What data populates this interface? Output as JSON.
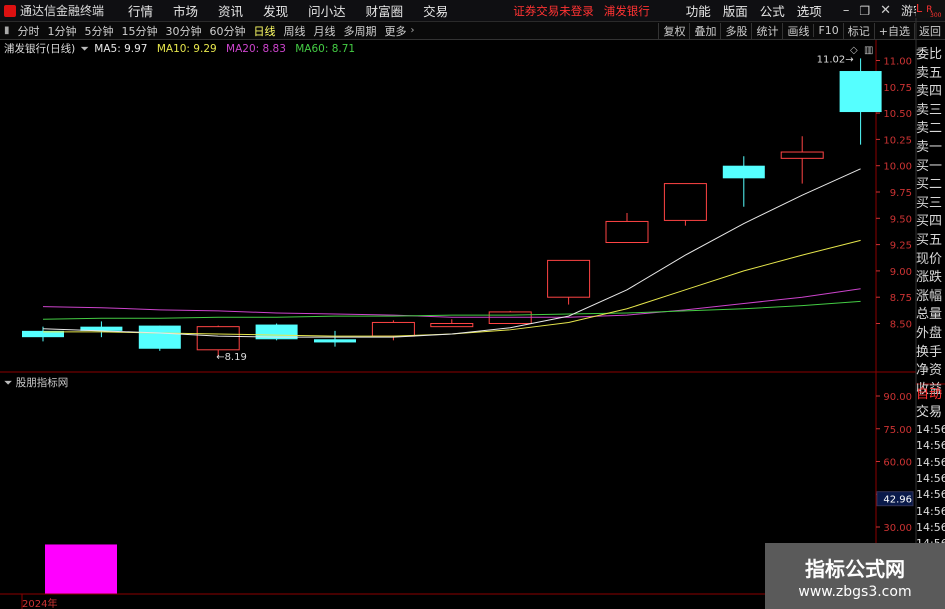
{
  "app": {
    "name": "通达信金融终端",
    "status_left": "证券交易未登录",
    "status_right": "浦发银行"
  },
  "menu": {
    "items": [
      "行情",
      "市场",
      "资讯",
      "发现",
      "问小达",
      "财富圈",
      "交易"
    ],
    "right_items": [
      "功能",
      "版面",
      "公式",
      "选项"
    ],
    "guest": "游客"
  },
  "periods": [
    "分时",
    "1分钟",
    "5分钟",
    "15分钟",
    "30分钟",
    "60分钟",
    "日线",
    "周线",
    "月线",
    "多周期",
    "更多"
  ],
  "active_period": "日线",
  "toolbar_right": [
    "复权",
    "叠加",
    "多股",
    "统计",
    "画线",
    "F10",
    "标记",
    "+自选",
    "返回"
  ],
  "legend": {
    "stock": "浦发银行(日线)",
    "ma5": "MA5: 9.97",
    "ma10": "MA10: 9.29",
    "ma20": "MA20: 8.83",
    "ma60": "MA60: 8.71"
  },
  "colors": {
    "up": "#ff4444",
    "down": "#55ffff",
    "ma5": "#e8e8e8",
    "ma10": "#e6e64c",
    "ma20": "#cc44cc",
    "ma60": "#44cc44",
    "grid": "#8b0000",
    "axis": "#cc3333"
  },
  "chart_data": {
    "type": "candlestick",
    "candles": [
      {
        "o": 8.43,
        "c": 8.37,
        "h": 8.47,
        "l": 8.33
      },
      {
        "o": 8.47,
        "c": 8.43,
        "h": 8.52,
        "l": 8.37
      },
      {
        "o": 8.48,
        "c": 8.26,
        "h": 8.48,
        "l": 8.24
      },
      {
        "o": 8.25,
        "c": 8.47,
        "h": 8.48,
        "l": 8.19
      },
      {
        "o": 8.49,
        "c": 8.35,
        "h": 8.5,
        "l": 8.34
      },
      {
        "o": 8.35,
        "c": 8.32,
        "h": 8.43,
        "l": 8.28
      },
      {
        "o": 8.38,
        "c": 8.51,
        "h": 8.53,
        "l": 8.34
      },
      {
        "o": 8.47,
        "c": 8.5,
        "h": 8.54,
        "l": 8.47
      },
      {
        "o": 8.5,
        "c": 8.61,
        "h": 8.62,
        "l": 8.5
      },
      {
        "o": 8.75,
        "c": 9.1,
        "h": 9.1,
        "l": 8.68
      },
      {
        "o": 9.27,
        "c": 9.47,
        "h": 9.55,
        "l": 9.27
      },
      {
        "o": 9.48,
        "c": 9.83,
        "h": 9.83,
        "l": 9.43
      },
      {
        "o": 10.0,
        "c": 9.88,
        "h": 10.09,
        "l": 9.61
      },
      {
        "o": 10.07,
        "c": 10.13,
        "h": 10.28,
        "l": 9.83
      },
      {
        "o": 10.9,
        "c": 10.51,
        "h": 11.02,
        "l": 10.2
      }
    ],
    "ma5": [
      8.45,
      8.43,
      8.41,
      8.38,
      8.37,
      8.37,
      8.37,
      8.4,
      8.46,
      8.57,
      8.82,
      9.15,
      9.45,
      9.72,
      9.97
    ],
    "ma10": [
      8.42,
      8.42,
      8.41,
      8.4,
      8.39,
      8.38,
      8.38,
      8.4,
      8.44,
      8.51,
      8.64,
      8.82,
      9.0,
      9.15,
      9.29
    ],
    "ma20": [
      8.66,
      8.65,
      8.63,
      8.62,
      8.6,
      8.59,
      8.58,
      8.56,
      8.56,
      8.56,
      8.58,
      8.63,
      8.69,
      8.75,
      8.83
    ],
    "ma60": [
      8.54,
      8.55,
      8.55,
      8.56,
      8.56,
      8.57,
      8.57,
      8.58,
      8.58,
      8.59,
      8.6,
      8.62,
      8.64,
      8.67,
      8.71
    ],
    "y_ticks": [
      "11.00",
      "10.75",
      "10.50",
      "10.25",
      "10.00",
      "9.75",
      "9.50",
      "9.25",
      "9.00",
      "8.75",
      "8.50"
    ],
    "y_range": [
      8.08,
      11.22
    ],
    "annotations": {
      "high": "11.02",
      "low": "8.19"
    },
    "indicator": {
      "name": "股朋指标网",
      "ticks": [
        "90.00",
        "75.00",
        "60.00",
        "45.00",
        "30.00"
      ],
      "current": "42.96",
      "bar_value": 22,
      "range": [
        0,
        100
      ]
    },
    "x_label": "2024年"
  },
  "sidebar": {
    "labels": [
      "委比",
      "卖五",
      "卖四",
      "卖三",
      "卖二",
      "卖一",
      "买一",
      "买二",
      "买三",
      "买四",
      "买五",
      "现价",
      "涨跌",
      "涨幅",
      "总量",
      "外盘",
      "换手",
      "净资",
      "收益"
    ],
    "bottom": [
      "自动",
      "交易"
    ],
    "times": [
      "14:56",
      "14:56",
      "14:56",
      "14:56",
      "14:56",
      "14:56",
      "14:56",
      "14:56",
      "14:56"
    ],
    "corner_l": "L",
    "corner_r": "R",
    "corner_n": "300"
  },
  "watermark": {
    "title": "指标公式网",
    "url": "www.zbgs3.com"
  }
}
